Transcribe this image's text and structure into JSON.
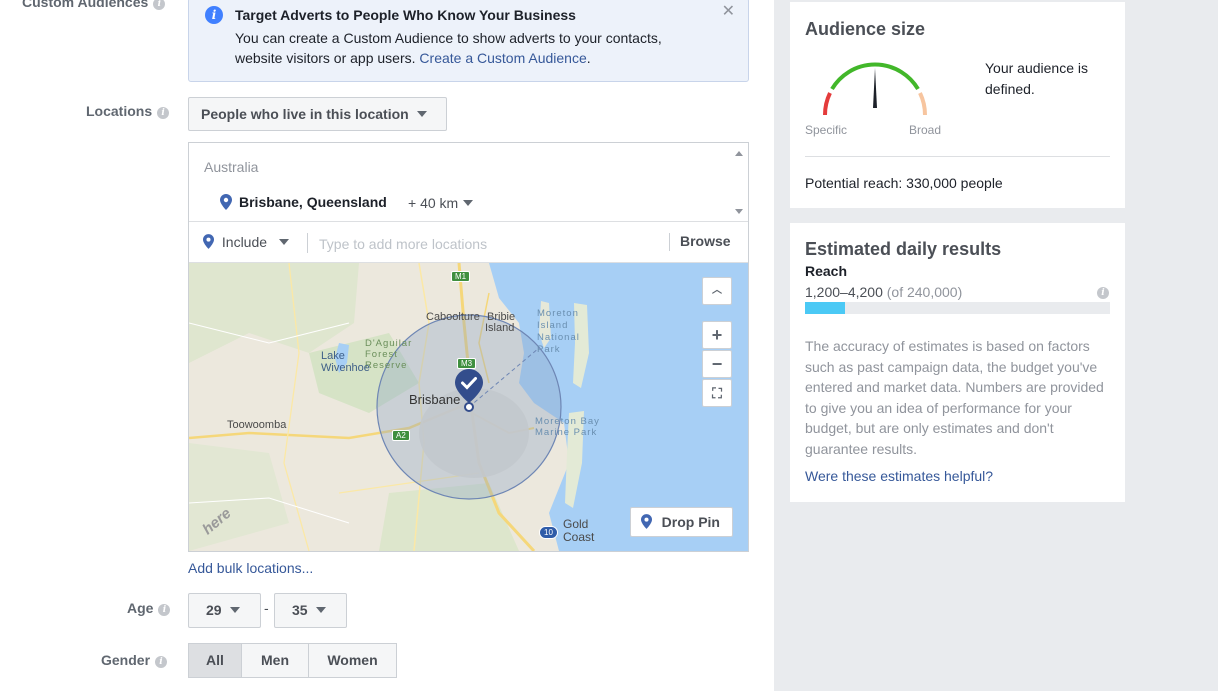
{
  "labels": {
    "custom_audiences": "Custom Audiences",
    "locations": "Locations",
    "age": "Age",
    "gender": "Gender"
  },
  "notice": {
    "title": "Target Adverts to People Who Know Your Business",
    "body": "You can create a Custom Audience to show adverts to your contacts, website visitors or app users.",
    "link": "Create a Custom Audience",
    "link_suffix": "."
  },
  "location_type": "People who live in this location",
  "locations": {
    "country": "Australia",
    "city": "Brisbane, Queensland",
    "radius": "+ 40 km",
    "include_label": "Include",
    "input_placeholder": "Type to add more locations",
    "browse": "Browse"
  },
  "map": {
    "drop_pin": "Drop Pin",
    "places": {
      "caboolture": "Caboolture",
      "bribie": "Bribie",
      "island": "Island",
      "moreton_island": "Moreton Island National Park",
      "daguilar": "D'Aguilar Forest Reserve",
      "lake_wivenhoe": "Lake Wivenhoe",
      "brisbane": "Brisbane",
      "toowoomba": "Toowoomba",
      "moreton_bay": "Moreton Bay Marine Park",
      "gold_coast": "Gold Coast"
    },
    "shields": {
      "m1": "M1",
      "m3": "M3",
      "a2": "A2",
      "r10": "10"
    },
    "watermark": "here"
  },
  "add_bulk": "Add bulk locations...",
  "age": {
    "min": "29",
    "max": "35",
    "separator": "-"
  },
  "gender": {
    "options": [
      "All",
      "Men",
      "Women"
    ],
    "selected": "All"
  },
  "audience_size": {
    "title": "Audience size",
    "status": "Your audience is defined.",
    "specific": "Specific",
    "broad": "Broad",
    "potential_reach": "Potential reach: 330,000 people"
  },
  "estimated": {
    "title": "Estimated daily results",
    "reach_label": "Reach",
    "range": "1,200–4,200",
    "of_total": "(of 240,000)",
    "fill_fraction": 0.13,
    "description": "The accuracy of estimates is based on factors such as past campaign data, the budget you've entered and market data. Numbers are provided to give you an idea of performance for your budget, but are only estimates and don't guarantee results.",
    "helpful_link": "Were these estimates helpful?"
  },
  "colors": {
    "link": "#365899",
    "accent": "#4080ff",
    "bar_fill": "#4bc9f5",
    "gauge_green": "#42b72a",
    "gauge_red": "#e43b3b",
    "gauge_orange": "#f7c59f"
  }
}
